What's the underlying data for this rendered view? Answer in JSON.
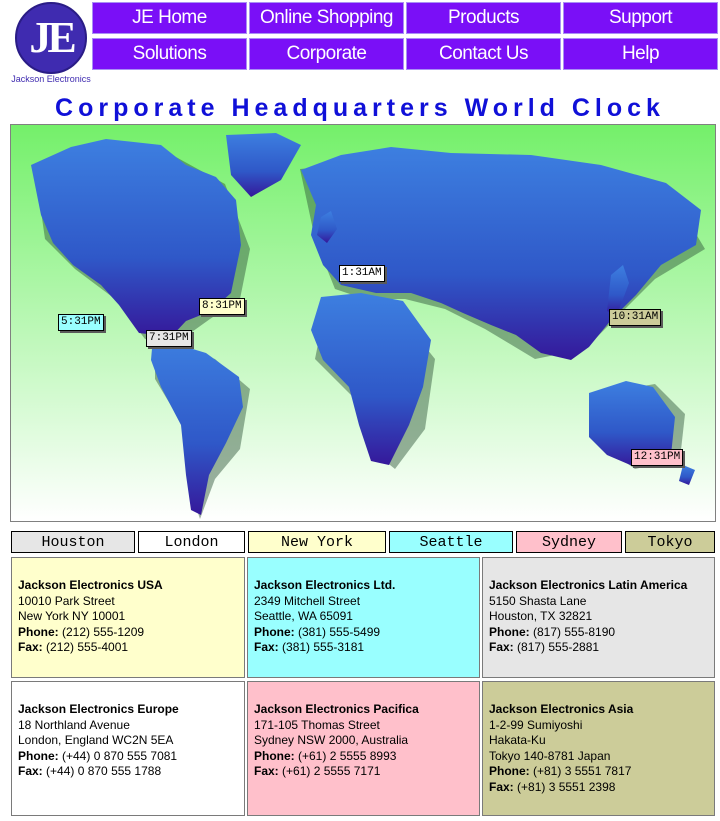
{
  "logo": {
    "letters": "JE",
    "company": "Jackson Electronics"
  },
  "nav": {
    "items": [
      {
        "label": "JE Home"
      },
      {
        "label": "Online Shopping"
      },
      {
        "label": "Products"
      },
      {
        "label": "Support"
      },
      {
        "label": "Solutions"
      },
      {
        "label": "Corporate"
      },
      {
        "label": "Contact Us"
      },
      {
        "label": "Help"
      }
    ]
  },
  "page": {
    "title": "Corporate Headquarters World Clock"
  },
  "clocks": [
    {
      "city": "Seattle",
      "time": "5:31PM",
      "color": "#99ffff"
    },
    {
      "city": "Houston",
      "time": "7:31PM",
      "color": "#e6e6e6"
    },
    {
      "city": "New York",
      "time": "8:31PM",
      "color": "#ffffcc"
    },
    {
      "city": "London",
      "time": "1:31AM",
      "color": "#ffffff"
    },
    {
      "city": "Tokyo",
      "time": "10:31AM",
      "color": "#cccc99"
    },
    {
      "city": "Sydney",
      "time": "12:31PM",
      "color": "#ffc0cb"
    }
  ],
  "tabs": [
    {
      "label": "Houston",
      "color": "#e6e6e6"
    },
    {
      "label": "London",
      "color": "#ffffff"
    },
    {
      "label": "New York",
      "color": "#ffffcc"
    },
    {
      "label": "Seattle",
      "color": "#99ffff"
    },
    {
      "label": "Sydney",
      "color": "#ffc0cb"
    },
    {
      "label": "Tokyo",
      "color": "#cccc99"
    }
  ],
  "offices": [
    {
      "name": "Jackson Electronics USA",
      "lines": [
        "10010 Park Street",
        "New York NY 10001"
      ],
      "phone_label": "Phone:",
      "phone": " (212) 555-1209",
      "fax_label": "Fax:",
      "fax": " (212) 555-4001",
      "color": "#ffffcc"
    },
    {
      "name": "Jackson Electronics Ltd.",
      "lines": [
        "2349 Mitchell Street",
        "Seattle, WA 65091"
      ],
      "phone_label": "Phone:",
      "phone": " (381) 555-5499",
      "fax_label": "Fax:",
      "fax": " (381) 555-3181",
      "color": "#99ffff"
    },
    {
      "name": "Jackson Electronics Latin America",
      "lines": [
        "5150 Shasta Lane",
        "Houston, TX 32821"
      ],
      "phone_label": "Phone:",
      "phone": " (817) 555-8190",
      "fax_label": "Fax:",
      "fax": " (817) 555-2881",
      "color": "#e6e6e6"
    },
    {
      "name": "Jackson Electronics Europe",
      "lines": [
        "18 Northland Avenue",
        "London, England WC2N 5EA"
      ],
      "phone_label": "Phone:",
      "phone": " (+44) 0 870 555 7081",
      "fax_label": "Fax:",
      "fax": " (+44) 0 870 555 1788",
      "color": "#ffffff"
    },
    {
      "name": "Jackson Electronics Pacifica",
      "lines": [
        "171-105 Thomas Street",
        "Sydney NSW 2000, Australia"
      ],
      "phone_label": "Phone:",
      "phone": " (+61) 2 5555 8993",
      "fax_label": "Fax:",
      "fax": " (+61) 2 5555 7171",
      "color": "#ffc0cb"
    },
    {
      "name": "Jackson Electronics Asia",
      "lines": [
        "1-2-99 Sumiyoshi",
        "Hakata-Ku",
        "Tokyo 140-8781 Japan"
      ],
      "phone_label": "Phone:",
      "phone": " (+81) 3 5551 7817",
      "fax_label": "Fax:",
      "fax": " (+81) 3 5551 2398",
      "color": "#cccc99"
    }
  ]
}
